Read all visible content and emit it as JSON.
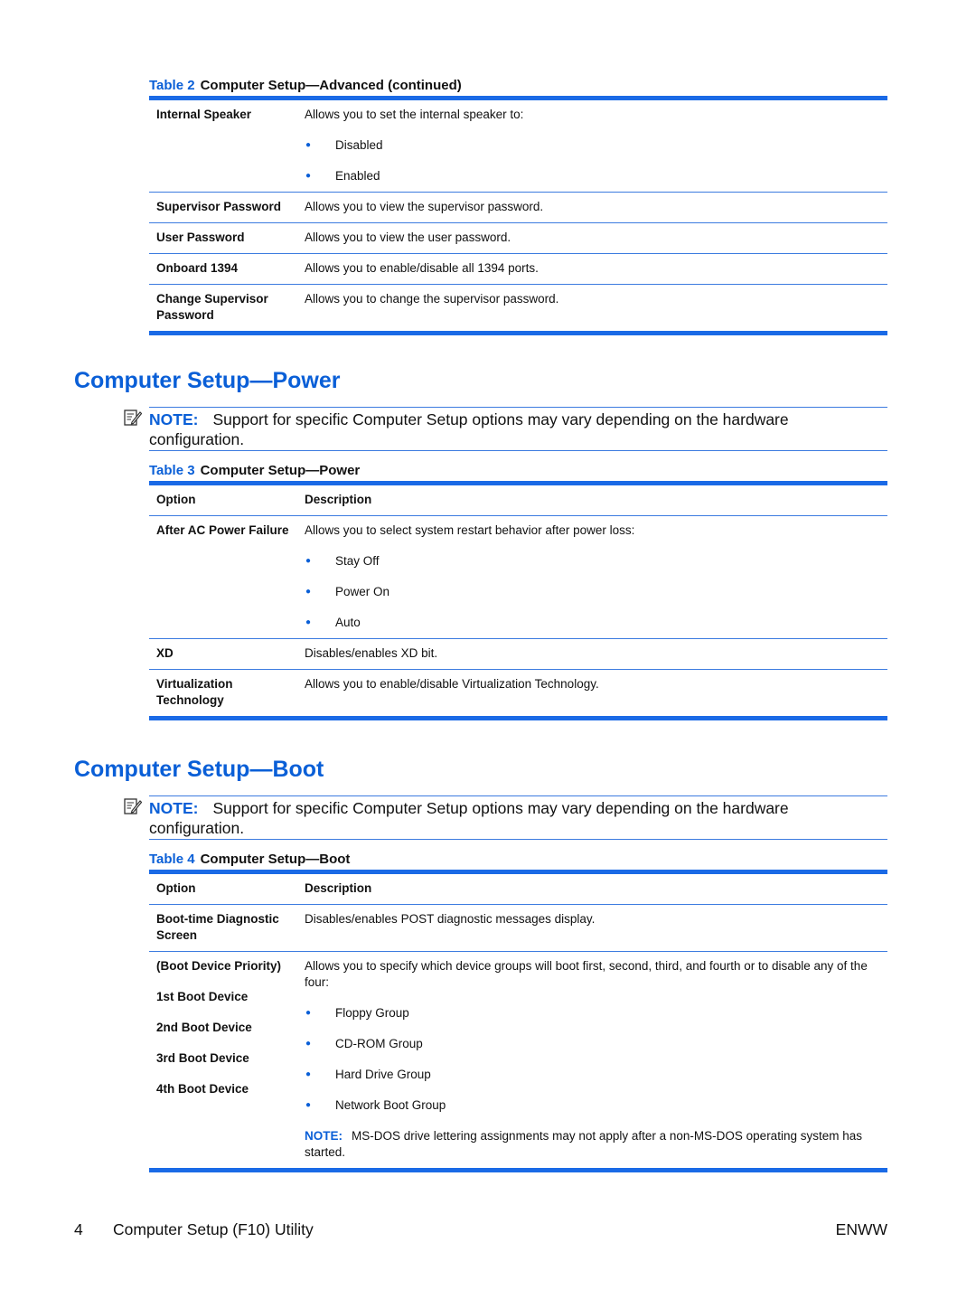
{
  "table2": {
    "number": "Table 2",
    "title": "Computer Setup—Advanced (continued)",
    "rows": [
      {
        "option": "Internal Speaker",
        "description": "Allows you to set the internal speaker to:",
        "bullets": [
          "Disabled",
          "Enabled"
        ]
      },
      {
        "option": "Supervisor Password",
        "description": "Allows you to view the supervisor password."
      },
      {
        "option": "User Password",
        "description": "Allows you to view the user password."
      },
      {
        "option": "Onboard 1394",
        "description": "Allows you to enable/disable all 1394 ports."
      },
      {
        "option_lines": [
          "Change Supervisor",
          "Password"
        ],
        "description": "Allows you to change the supervisor password."
      }
    ]
  },
  "power_section": {
    "heading": "Computer Setup—Power",
    "note_label": "NOTE:",
    "note_text": "Support for specific Computer Setup options may vary depending on the hardware configuration."
  },
  "table3": {
    "number": "Table 3",
    "title": "Computer Setup—Power",
    "headers": [
      "Option",
      "Description"
    ],
    "rows": [
      {
        "option": "After AC Power Failure",
        "description": "Allows you to select system restart behavior after power loss:",
        "bullets": [
          "Stay Off",
          "Power On",
          "Auto"
        ]
      },
      {
        "option": "XD",
        "description": "Disables/enables XD bit."
      },
      {
        "option_lines": [
          "Virtualization",
          "Technology"
        ],
        "description": "Allows you to enable/disable Virtualization Technology."
      }
    ]
  },
  "boot_section": {
    "heading": "Computer Setup—Boot",
    "note_label": "NOTE:",
    "note_text": "Support for specific Computer Setup options may vary depending on the hardware configuration."
  },
  "table4": {
    "number": "Table 4",
    "title": "Computer Setup—Boot",
    "headers": [
      "Option",
      "Description"
    ],
    "rows": [
      {
        "option_lines": [
          "Boot-time Diagnostic",
          "Screen"
        ],
        "description": "Disables/enables POST diagnostic messages display."
      },
      {
        "option_lines": [
          "(Boot Device Priority)",
          "1st Boot Device",
          "2nd Boot Device",
          "3rd Boot Device",
          "4th Boot Device"
        ],
        "description": "Allows you to specify which device groups will boot first, second, third, and fourth or to disable any of the four:",
        "bullets": [
          "Floppy Group",
          "CD-ROM Group",
          "Hard Drive Group",
          "Network Boot Group"
        ],
        "note_label": "NOTE:",
        "note_text": "MS-DOS drive lettering assignments may not apply after a non-MS-DOS operating system has started."
      }
    ]
  },
  "footer": {
    "page_number": "4",
    "chapter": "Computer Setup (F10) Utility",
    "locale": "ENWW"
  },
  "icons": {
    "note": "note-pencil-icon",
    "bullet": "●"
  }
}
